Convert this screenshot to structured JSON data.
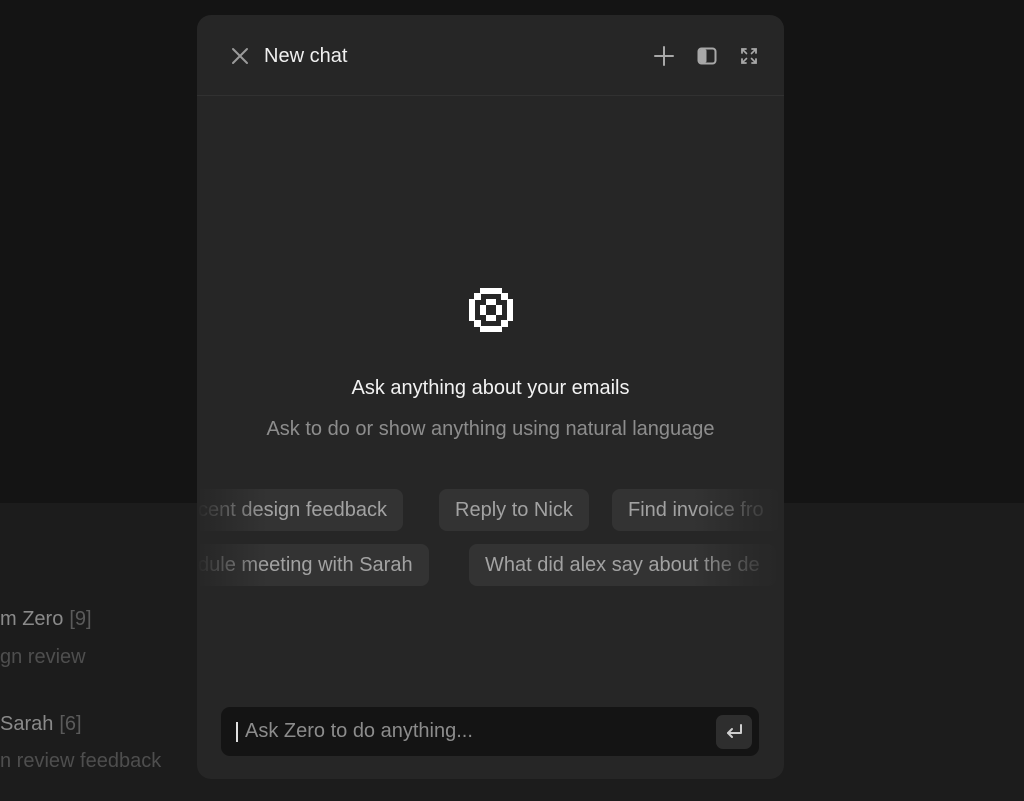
{
  "background_list": {
    "items": [
      {
        "sender": "m Zero",
        "count": "[9]",
        "subject": "gn review"
      },
      {
        "sender": "Sarah",
        "count": "[6]",
        "subject": "n review feedback"
      }
    ]
  },
  "chat": {
    "title": "New chat",
    "empty_state": {
      "title": "Ask anything about your emails",
      "subtitle": "Ask to do or show anything using natural language"
    },
    "suggestions": {
      "row1": [
        "cent design feedback",
        "Reply to Nick",
        "Find invoice fro"
      ],
      "row2": [
        "dule meeting with Sarah",
        "What did alex say about the de"
      ]
    },
    "composer": {
      "placeholder": "Ask Zero to do anything...",
      "value": ""
    }
  },
  "icons": {
    "close": "close-icon",
    "new_chat": "plus-icon",
    "sidebar": "sidebar-toggle-icon",
    "expand": "expand-icon",
    "logo": "zero-logo-icon",
    "send": "enter-icon"
  },
  "colors": {
    "backdrop": "#141414",
    "panel": "#262626",
    "chip": "#333333",
    "composer": "#141414"
  }
}
